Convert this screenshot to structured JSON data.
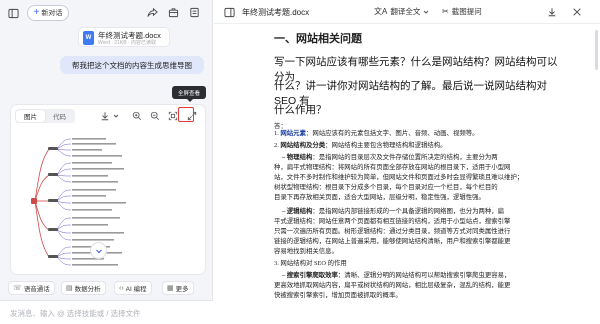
{
  "left_panel": {
    "new_chat_label": "新对话",
    "file": {
      "icon_letter": "W",
      "name": "年终测试考题.docx",
      "meta": "Word · 21KB · 内容已读取"
    },
    "user_message": "帮我把这个文档的内容生成思维导图",
    "tooltip": "全屏查看",
    "tabs": [
      "图片",
      "代码"
    ],
    "chips": [
      {
        "icon": "语音通话-icon",
        "label": "语音通话"
      },
      {
        "icon": "数据分析-icon",
        "label": "数据分析"
      },
      {
        "icon": "AI编程-icon",
        "label": "AI 编程"
      },
      {
        "icon": "更多-icon",
        "label": "更多"
      }
    ],
    "input_placeholder": "发消息、输入 @ 选择技能或 / 选择文件"
  },
  "right_panel": {
    "doc_title": "年终测试考题.docx",
    "translate_label": "翻译全文",
    "screenshot_label": "截图提问",
    "section_heading": "一、网站相关问题",
    "question_lines": [
      "写一下网站应该有哪些元素？什么是网站结构？网站结构可以分为",
      "什么？讲一讲你对网站结构的了解。最后说一说网站结构对 SEO 有",
      "什么作用？"
    ],
    "answer_label": "答：",
    "paragraphs": [
      {
        "num": "1.",
        "bold": "网站元素",
        "text": "：网站应该有的元素包括文字、图片、音频、动画、视频等。"
      },
      {
        "num": "2.",
        "bold": "网站结构及分类",
        "text": "：网站结构主要包含物理结构和逻辑结构。"
      },
      {
        "bold": "– 物理结构",
        "text": "：是指网站的目录层次及文件存储位置所决定的结构，主要分为两"
      },
      {
        "text": "种，扁平式物理结构：将网站的所有页面全部存放在网站的根目录下，适用于小型网"
      },
      {
        "text": "站，文件不多时制作和维护较为简单，但网站文件和页面过多时会显得繁琐且难以维护；"
      },
      {
        "text": "树状型物理结构：根目录下分成多个目录，每个目录对应一个栏目，每个栏目的"
      },
      {
        "text": "目录下再存放相关页面，适合大型网站，层级分明，稳定性强，逻辑性强。"
      },
      {
        "bold": "– 逻辑结构",
        "text": "：是指网站内部链接形成的一个具备逻辑的网络图，也分为两种，扁"
      },
      {
        "text": "平式逻辑结构：网站任意两个页面都有相互链接的结构，适用于小型站点，搜索引擎"
      },
      {
        "text": "只需一次遍历所有页面。树形逻辑结构：通过分类目录，频道等方式对同类属性进行"
      },
      {
        "text": "链接的逻辑结构，在网站上普遍采用，能够使网站结构清晰，用户和搜索引擎都能更"
      },
      {
        "text": "容易地找到相关信息。"
      },
      {
        "num": "3.",
        "text": "网站结构对 SEO 的作用"
      },
      {
        "bold": "– 搜索引擎爬取效率",
        "text": "：清晰、逻辑分明的网站结构可以帮助搜索引擎爬虫更容易，"
      },
      {
        "text": "更高效地抓取网站内容，扁平或树状结构的网站，相比层级复杂，混乱的结构，能更"
      },
      {
        "text": "快被搜索引擎索引，增加页面被抓取的概率。"
      }
    ]
  },
  "colors": {
    "accent": "#4a6cf7",
    "highlight_border": "#e53935",
    "word_blue": "#3f7af2"
  }
}
